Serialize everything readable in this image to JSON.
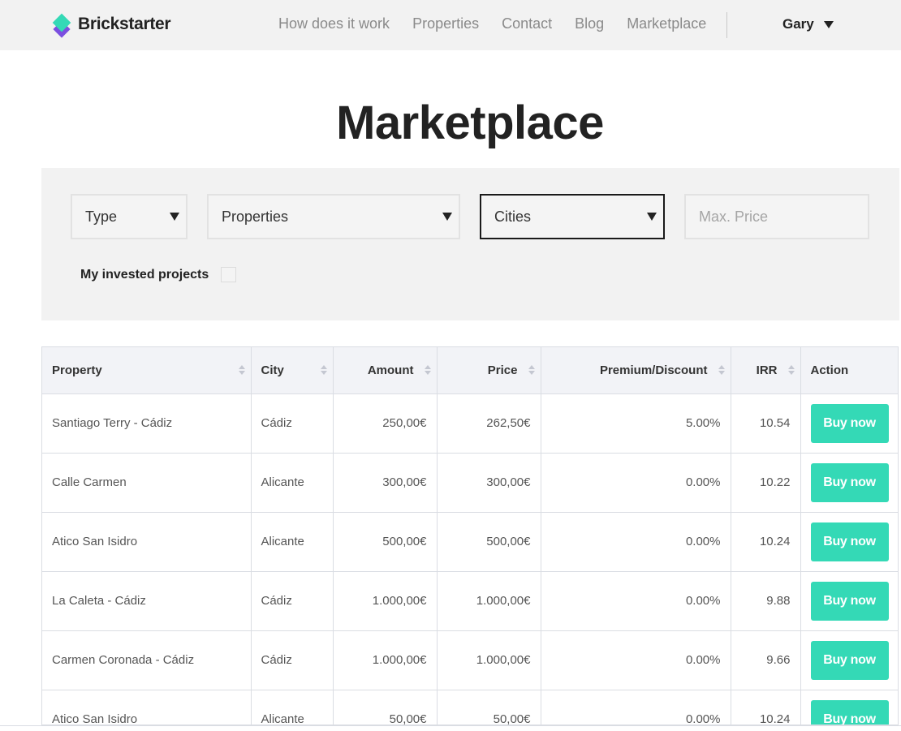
{
  "header": {
    "brand": "Brickstarter",
    "nav": [
      "How does it work",
      "Properties",
      "Contact",
      "Blog",
      "Marketplace"
    ],
    "user": "Gary"
  },
  "page": {
    "title": "Marketplace"
  },
  "filters": {
    "type_label": "Type",
    "properties_label": "Properties",
    "cities_label": "Cities",
    "max_price_placeholder": "Max. Price",
    "invested_label": "My invested projects"
  },
  "table": {
    "headers": {
      "property": "Property",
      "city": "City",
      "amount": "Amount",
      "price": "Price",
      "premium": "Premium/Discount",
      "irr": "IRR",
      "action": "Action"
    },
    "rows": [
      {
        "property": "Santiago Terry - Cádiz",
        "city": "Cádiz",
        "amount": "250,00€",
        "price": "262,50€",
        "premium": "5.00%",
        "irr": "10.54",
        "action": "Buy now"
      },
      {
        "property": "Calle Carmen",
        "city": "Alicante",
        "amount": "300,00€",
        "price": "300,00€",
        "premium": "0.00%",
        "irr": "10.22",
        "action": "Buy now"
      },
      {
        "property": "Atico San Isidro",
        "city": "Alicante",
        "amount": "500,00€",
        "price": "500,00€",
        "premium": "0.00%",
        "irr": "10.24",
        "action": "Buy now"
      },
      {
        "property": "La Caleta - Cádiz",
        "city": "Cádiz",
        "amount": "1.000,00€",
        "price": "1.000,00€",
        "premium": "0.00%",
        "irr": "9.88",
        "action": "Buy now"
      },
      {
        "property": "Carmen Coronada - Cádiz",
        "city": "Cádiz",
        "amount": "1.000,00€",
        "price": "1.000,00€",
        "premium": "0.00%",
        "irr": "9.66",
        "action": "Buy now"
      },
      {
        "property": "Atico San Isidro",
        "city": "Alicante",
        "amount": "50,00€",
        "price": "50,00€",
        "premium": "0.00%",
        "irr": "10.24",
        "action": "Buy now"
      }
    ]
  },
  "colors": {
    "accent": "#34d9b6",
    "brand_secondary": "#7b4fe0",
    "header_bg": "#f2f2f2"
  }
}
